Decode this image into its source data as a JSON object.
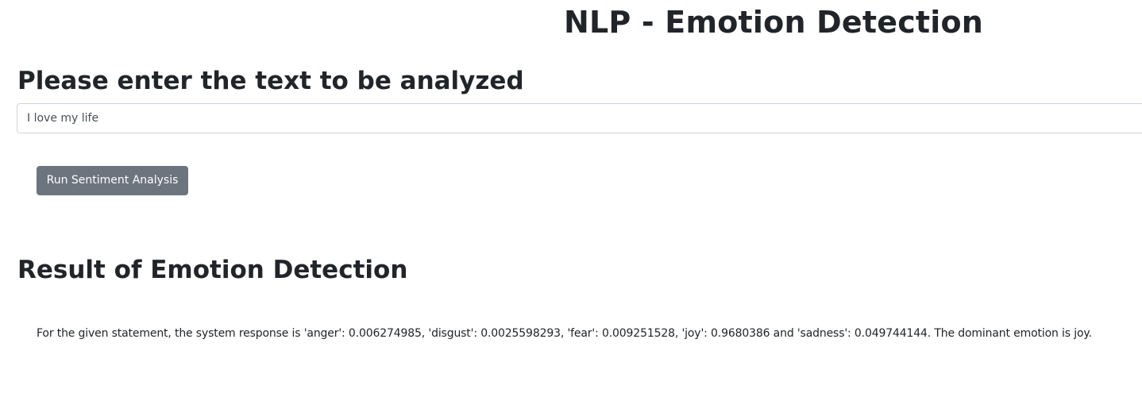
{
  "header": {
    "title": "NLP - Emotion Detection"
  },
  "input_section": {
    "heading": "Please enter the text to be analyzed",
    "input_value": "I love my life"
  },
  "actions": {
    "run_label": "Run Sentiment Analysis"
  },
  "result_section": {
    "heading": "Result of Emotion Detection",
    "text": "For the given statement, the system response is 'anger': 0.006274985, 'disgust': 0.0025598293, 'fear': 0.009251528, 'joy': 0.9680386 and 'sadness': 0.049744144. The dominant emotion is joy."
  }
}
